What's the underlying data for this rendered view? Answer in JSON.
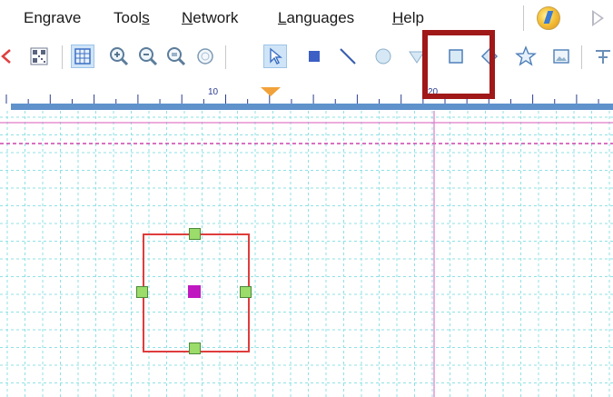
{
  "menu": {
    "engrave": "Engrave",
    "tools_prefix": "Tool",
    "tools_accel": "s",
    "network_accel": "N",
    "network_rest": "etwork",
    "languages_accel": "L",
    "languages_rest": "anguages",
    "help_accel": "H",
    "help_rest": "elp"
  },
  "icons": {
    "run": "run-wizard-icon",
    "play": "play-icon"
  },
  "toolbar": {
    "tools": [
      "back-icon",
      "qr-code-icon",
      "grid-icon",
      "zoom-in-icon",
      "zoom-out-icon",
      "zoom-100-icon",
      "zoom-fit-icon",
      "select-arrow-icon",
      "rectangle-icon",
      "line-icon",
      "ellipse-icon",
      "triangle-icon",
      "square-icon",
      "diamond-icon",
      "star-icon",
      "image-icon",
      "text-icon"
    ],
    "active_tools": [
      "grid-icon",
      "select-arrow-icon"
    ]
  },
  "ruler": {
    "label_10": "10",
    "label_20": "20"
  },
  "colors": {
    "highlight": "#a01818",
    "grid": "#8fe1e6",
    "guide": "#e07ac8",
    "shape_border": "#e03c3c",
    "handle": "#9bdc6a",
    "center": "#c018c0",
    "ruler": "#5f91cb"
  }
}
